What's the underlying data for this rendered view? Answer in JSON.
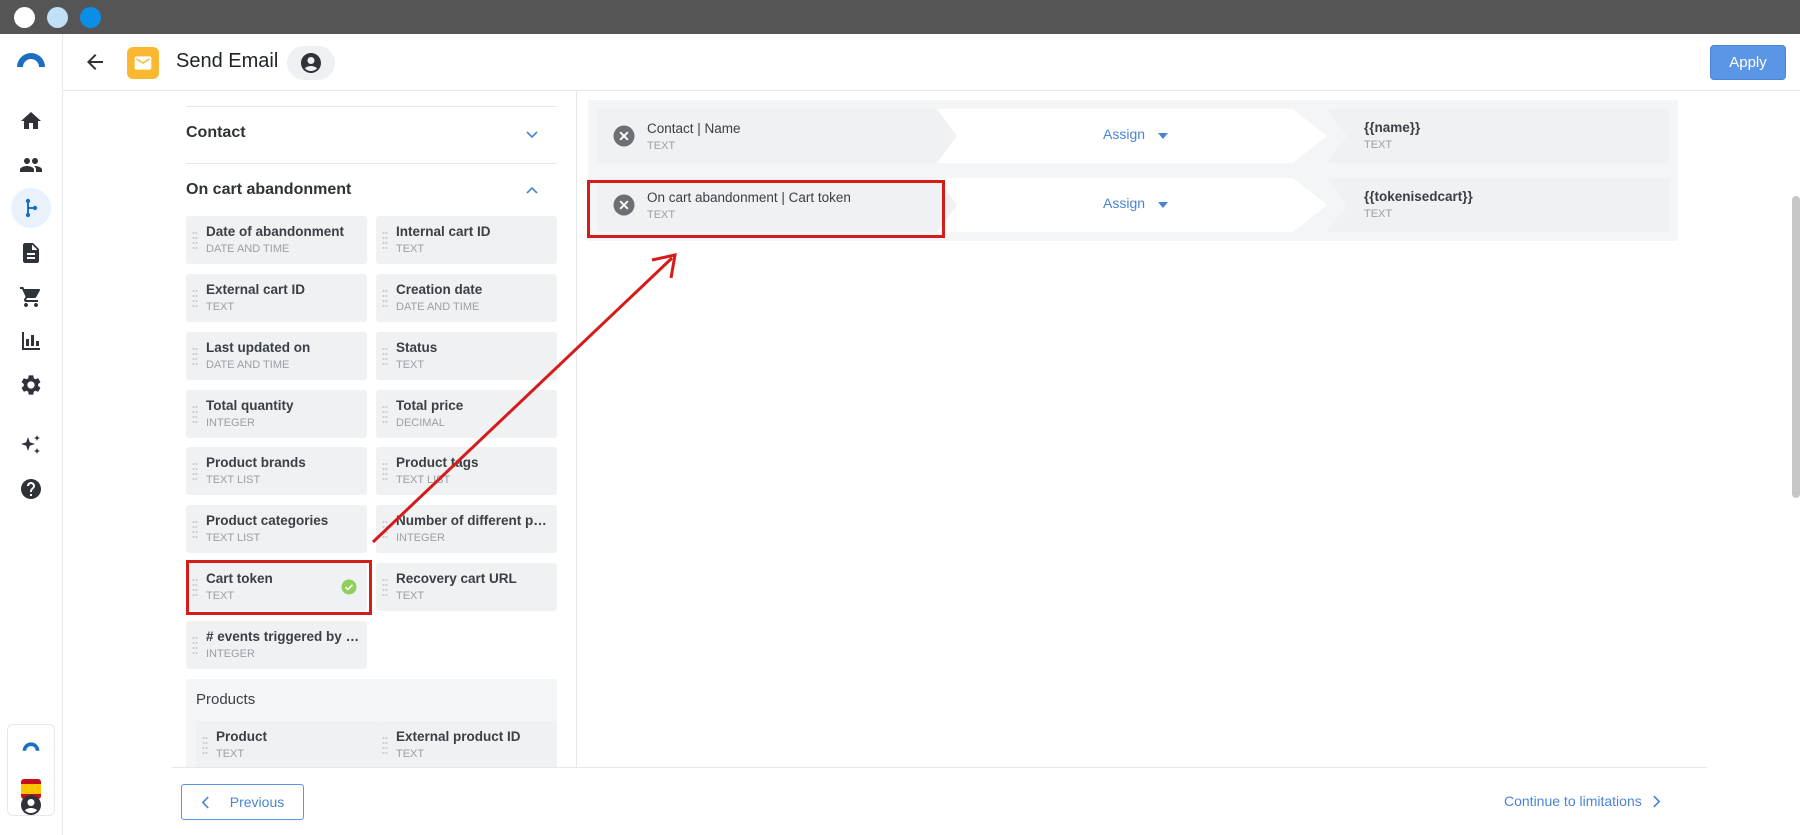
{
  "header": {
    "title": "Send Email",
    "apply_label": "Apply"
  },
  "left_panel": {
    "sections": [
      {
        "title": "Contact",
        "expanded": false
      },
      {
        "title": "On cart abandonment",
        "expanded": true
      }
    ],
    "cards": [
      {
        "name": "Date of abandonment",
        "type": "DATE AND TIME"
      },
      {
        "name": "Internal cart ID",
        "type": "TEXT"
      },
      {
        "name": "External cart ID",
        "type": "TEXT"
      },
      {
        "name": "Creation date",
        "type": "DATE AND TIME"
      },
      {
        "name": "Last updated on",
        "type": "DATE AND TIME"
      },
      {
        "name": "Status",
        "type": "TEXT"
      },
      {
        "name": "Total quantity",
        "type": "INTEGER"
      },
      {
        "name": "Total price",
        "type": "DECIMAL"
      },
      {
        "name": "Product brands",
        "type": "TEXT LIST"
      },
      {
        "name": "Product tags",
        "type": "TEXT LIST"
      },
      {
        "name": "Product categories",
        "type": "TEXT LIST"
      },
      {
        "name": "Number of different pr…",
        "type": "INTEGER"
      },
      {
        "name": "Cart token",
        "type": "TEXT",
        "assigned": true
      },
      {
        "name": "Recovery cart URL",
        "type": "TEXT"
      },
      {
        "name": "# events triggered by t…",
        "type": "INTEGER"
      }
    ],
    "products_title": "Products",
    "product_cards": [
      {
        "name": "Product",
        "type": "TEXT"
      },
      {
        "name": "External product ID",
        "type": "TEXT"
      }
    ]
  },
  "mappings": [
    {
      "source_name": "Contact | Name",
      "source_type": "TEXT",
      "action": "Assign",
      "target_name": "{{name}}",
      "target_type": "TEXT"
    },
    {
      "source_name": "On cart abandonment | Cart token",
      "source_type": "TEXT",
      "action": "Assign",
      "target_name": "{{tokenisedcart}}",
      "target_type": "TEXT"
    }
  ],
  "footer": {
    "previous_label": "Previous",
    "continue_label": "Continue to limitations"
  },
  "colors": {
    "accent": "#4a84d4",
    "apply_bg": "#5b95e6",
    "badge": "#f9b82f",
    "highlight": "#d61b1b",
    "check": "#8fcf5a"
  },
  "icons": [
    "home-icon",
    "people-icon",
    "flow-icon",
    "document-icon",
    "cart-icon",
    "chart-icon",
    "gear-icon",
    "sparkle-icon",
    "help-icon",
    "user-icon"
  ]
}
